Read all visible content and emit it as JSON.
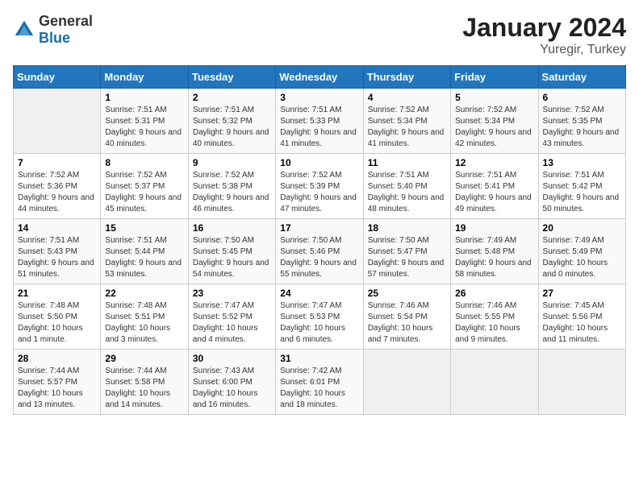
{
  "logo": {
    "general": "General",
    "blue": "Blue"
  },
  "header": {
    "month": "January 2024",
    "location": "Yuregir, Turkey"
  },
  "weekdays": [
    "Sunday",
    "Monday",
    "Tuesday",
    "Wednesday",
    "Thursday",
    "Friday",
    "Saturday"
  ],
  "weeks": [
    [
      null,
      {
        "day": "1",
        "sunrise": "7:51 AM",
        "sunset": "5:31 PM",
        "daylight": "9 hours and 40 minutes."
      },
      {
        "day": "2",
        "sunrise": "7:51 AM",
        "sunset": "5:32 PM",
        "daylight": "9 hours and 40 minutes."
      },
      {
        "day": "3",
        "sunrise": "7:51 AM",
        "sunset": "5:33 PM",
        "daylight": "9 hours and 41 minutes."
      },
      {
        "day": "4",
        "sunrise": "7:52 AM",
        "sunset": "5:34 PM",
        "daylight": "9 hours and 41 minutes."
      },
      {
        "day": "5",
        "sunrise": "7:52 AM",
        "sunset": "5:34 PM",
        "daylight": "9 hours and 42 minutes."
      },
      {
        "day": "6",
        "sunrise": "7:52 AM",
        "sunset": "5:35 PM",
        "daylight": "9 hours and 43 minutes."
      }
    ],
    [
      {
        "day": "7",
        "sunrise": "7:52 AM",
        "sunset": "5:36 PM",
        "daylight": "9 hours and 44 minutes."
      },
      {
        "day": "8",
        "sunrise": "7:52 AM",
        "sunset": "5:37 PM",
        "daylight": "9 hours and 45 minutes."
      },
      {
        "day": "9",
        "sunrise": "7:52 AM",
        "sunset": "5:38 PM",
        "daylight": "9 hours and 46 minutes."
      },
      {
        "day": "10",
        "sunrise": "7:52 AM",
        "sunset": "5:39 PM",
        "daylight": "9 hours and 47 minutes."
      },
      {
        "day": "11",
        "sunrise": "7:51 AM",
        "sunset": "5:40 PM",
        "daylight": "9 hours and 48 minutes."
      },
      {
        "day": "12",
        "sunrise": "7:51 AM",
        "sunset": "5:41 PM",
        "daylight": "9 hours and 49 minutes."
      },
      {
        "day": "13",
        "sunrise": "7:51 AM",
        "sunset": "5:42 PM",
        "daylight": "9 hours and 50 minutes."
      }
    ],
    [
      {
        "day": "14",
        "sunrise": "7:51 AM",
        "sunset": "5:43 PM",
        "daylight": "9 hours and 51 minutes."
      },
      {
        "day": "15",
        "sunrise": "7:51 AM",
        "sunset": "5:44 PM",
        "daylight": "9 hours and 53 minutes."
      },
      {
        "day": "16",
        "sunrise": "7:50 AM",
        "sunset": "5:45 PM",
        "daylight": "9 hours and 54 minutes."
      },
      {
        "day": "17",
        "sunrise": "7:50 AM",
        "sunset": "5:46 PM",
        "daylight": "9 hours and 55 minutes."
      },
      {
        "day": "18",
        "sunrise": "7:50 AM",
        "sunset": "5:47 PM",
        "daylight": "9 hours and 57 minutes."
      },
      {
        "day": "19",
        "sunrise": "7:49 AM",
        "sunset": "5:48 PM",
        "daylight": "9 hours and 58 minutes."
      },
      {
        "day": "20",
        "sunrise": "7:49 AM",
        "sunset": "5:49 PM",
        "daylight": "10 hours and 0 minutes."
      }
    ],
    [
      {
        "day": "21",
        "sunrise": "7:48 AM",
        "sunset": "5:50 PM",
        "daylight": "10 hours and 1 minute."
      },
      {
        "day": "22",
        "sunrise": "7:48 AM",
        "sunset": "5:51 PM",
        "daylight": "10 hours and 3 minutes."
      },
      {
        "day": "23",
        "sunrise": "7:47 AM",
        "sunset": "5:52 PM",
        "daylight": "10 hours and 4 minutes."
      },
      {
        "day": "24",
        "sunrise": "7:47 AM",
        "sunset": "5:53 PM",
        "daylight": "10 hours and 6 minutes."
      },
      {
        "day": "25",
        "sunrise": "7:46 AM",
        "sunset": "5:54 PM",
        "daylight": "10 hours and 7 minutes."
      },
      {
        "day": "26",
        "sunrise": "7:46 AM",
        "sunset": "5:55 PM",
        "daylight": "10 hours and 9 minutes."
      },
      {
        "day": "27",
        "sunrise": "7:45 AM",
        "sunset": "5:56 PM",
        "daylight": "10 hours and 11 minutes."
      }
    ],
    [
      {
        "day": "28",
        "sunrise": "7:44 AM",
        "sunset": "5:57 PM",
        "daylight": "10 hours and 13 minutes."
      },
      {
        "day": "29",
        "sunrise": "7:44 AM",
        "sunset": "5:58 PM",
        "daylight": "10 hours and 14 minutes."
      },
      {
        "day": "30",
        "sunrise": "7:43 AM",
        "sunset": "6:00 PM",
        "daylight": "10 hours and 16 minutes."
      },
      {
        "day": "31",
        "sunrise": "7:42 AM",
        "sunset": "6:01 PM",
        "daylight": "10 hours and 18 minutes."
      },
      null,
      null,
      null
    ]
  ]
}
